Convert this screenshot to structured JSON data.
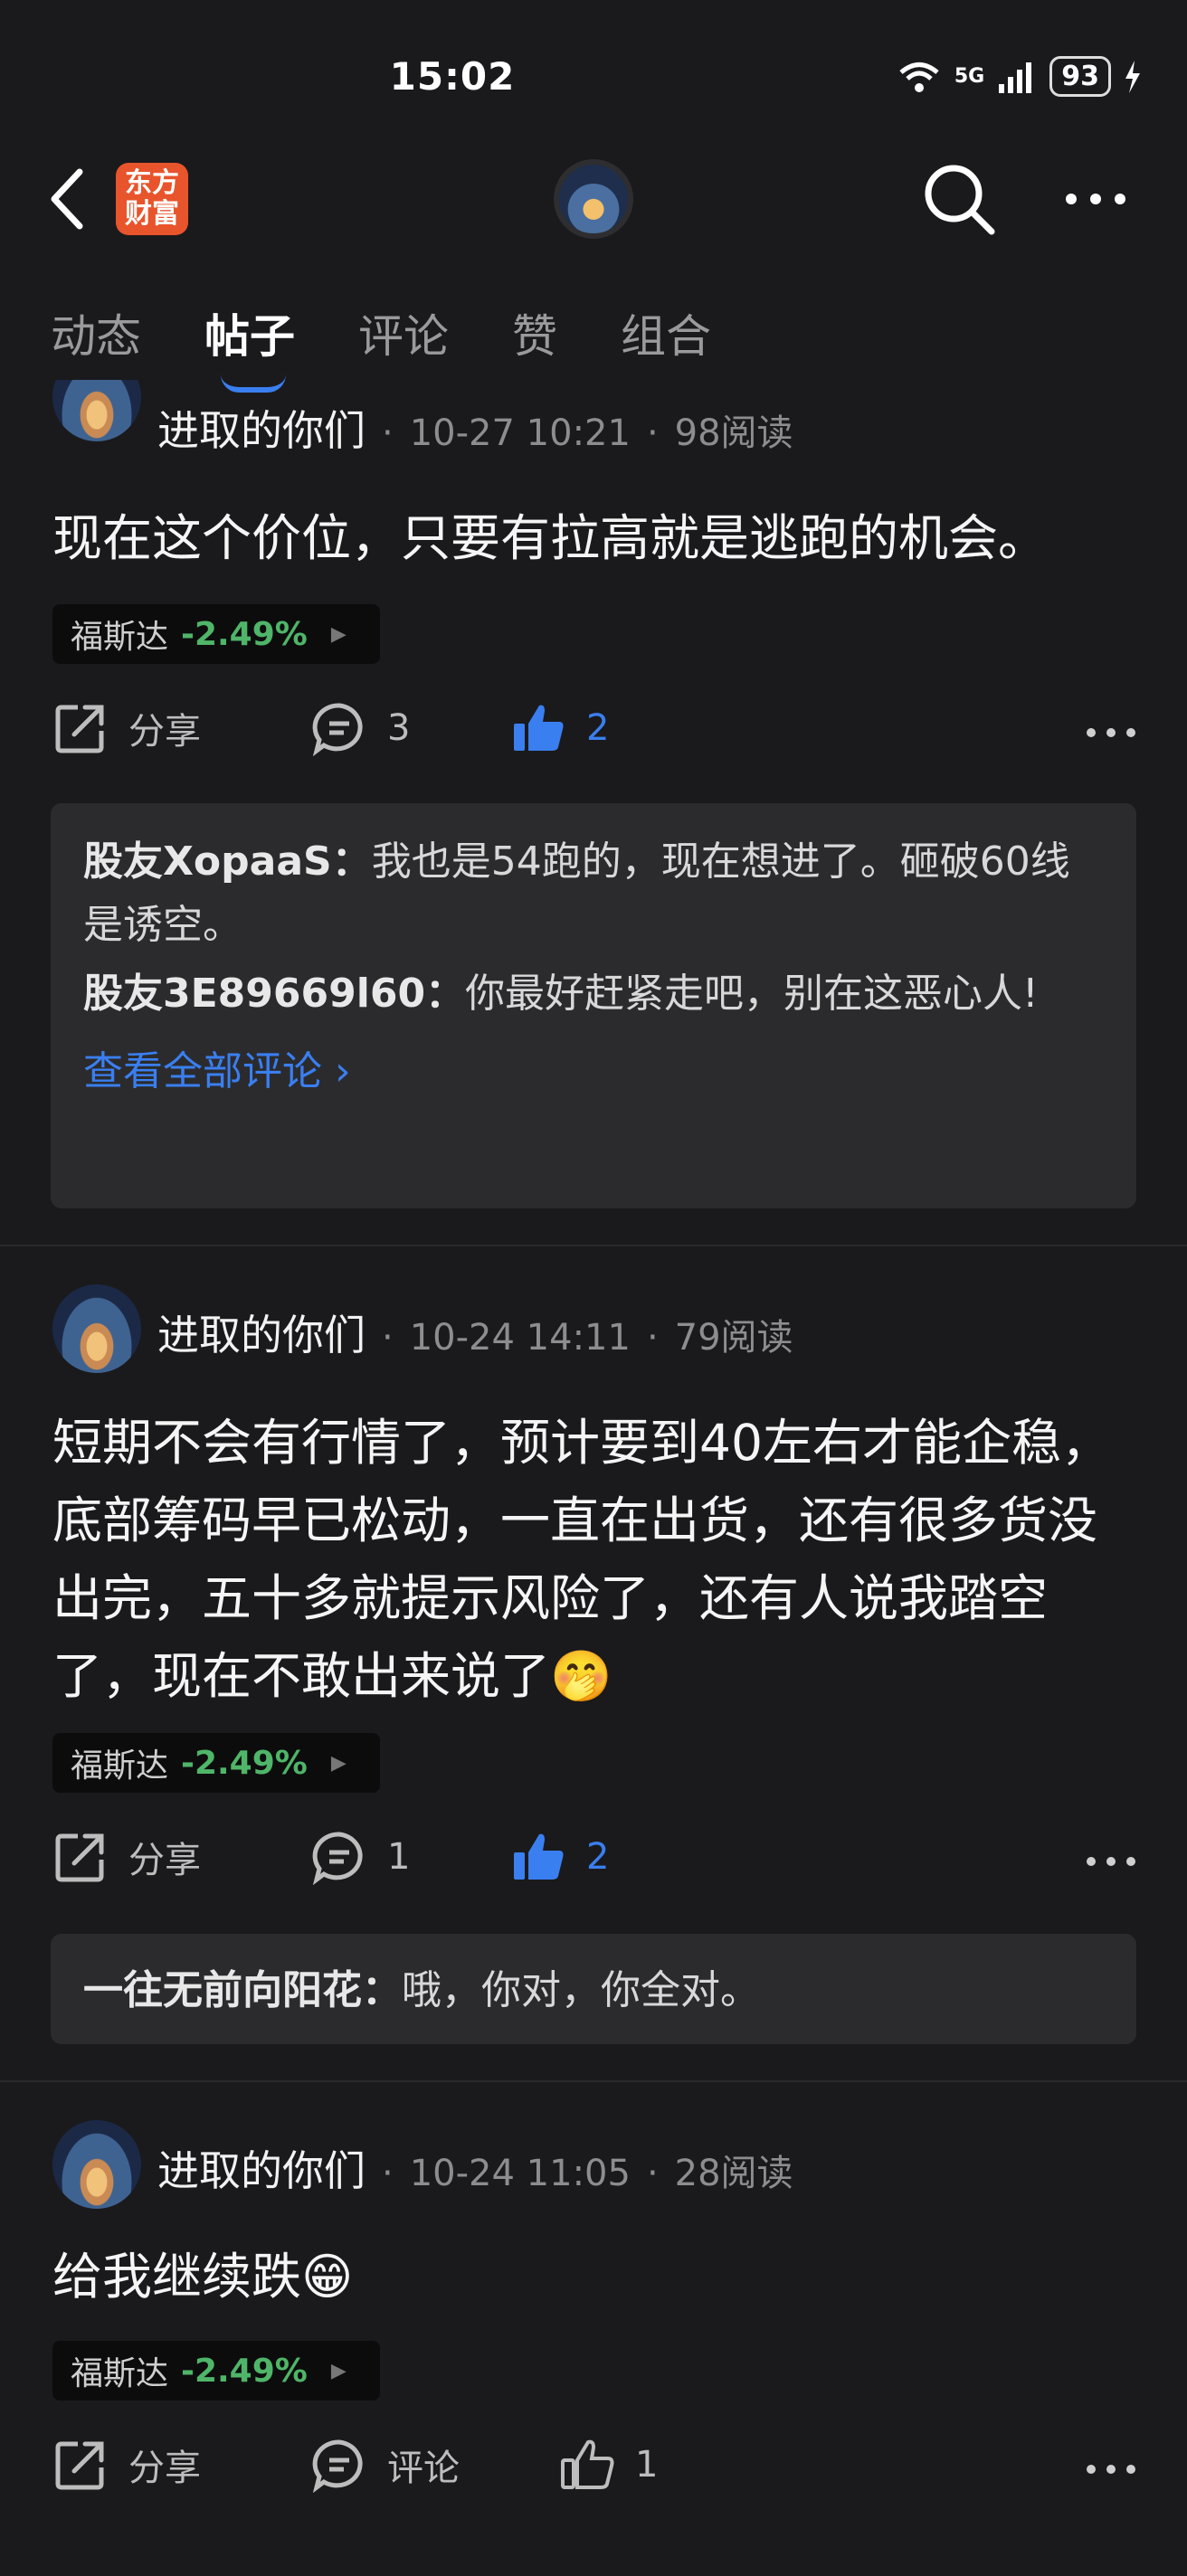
{
  "status_bar": {
    "time": "15:02",
    "network": "5G",
    "battery": "93"
  },
  "header": {
    "logo_line1": "东方",
    "logo_line2": "财富"
  },
  "tabs": [
    {
      "label": "动态"
    },
    {
      "label": "帖子"
    },
    {
      "label": "评论"
    },
    {
      "label": "赞"
    },
    {
      "label": "组合"
    }
  ],
  "posts": [
    {
      "author": "进取的你们",
      "time": "10-27 10:21",
      "reads": "98阅读",
      "text": "现在这个价位，只要有拉高就是逃跑的机会。",
      "stock": {
        "name": "福斯达",
        "change": "-2.49%"
      },
      "share_label": "分享",
      "comment_count": "3",
      "like_count": "2",
      "comments": [
        {
          "user": "股友XopaaS：",
          "text": "我也是54跑的，现在想进了。砸破60线是诱空。"
        },
        {
          "user": "股友3E89669l60：",
          "text": "你最好赶紧走吧，别在这恶心人!"
        }
      ],
      "view_all": "查看全部评论 ›"
    },
    {
      "author": "进取的你们",
      "time": "10-24 14:11",
      "reads": "79阅读",
      "text": "短期不会有行情了，预计要到40左右才能企稳，底部筹码早已松动，一直在出货，还有很多货没出完，五十多就提示风险了，还有人说我踏空了，现在不敢出来说了🤭",
      "stock": {
        "name": "福斯达",
        "change": "-2.49%"
      },
      "share_label": "分享",
      "comment_count": "1",
      "like_count": "2",
      "comments": [
        {
          "user": "一往无前向阳花：",
          "text": "哦，你对，你全对。"
        }
      ]
    },
    {
      "author": "进取的你们",
      "time": "10-24 11:05",
      "reads": "28阅读",
      "text": "给我继续跌😁",
      "stock": {
        "name": "福斯达",
        "change": "-2.49%"
      },
      "share_label": "分享",
      "comment_label": "评论",
      "like_count": "1"
    }
  ],
  "meta_separator": "·",
  "colors": {
    "accent": "#3a7ff0",
    "stock_change": "#4fb568",
    "background": "#1a1a1c"
  }
}
